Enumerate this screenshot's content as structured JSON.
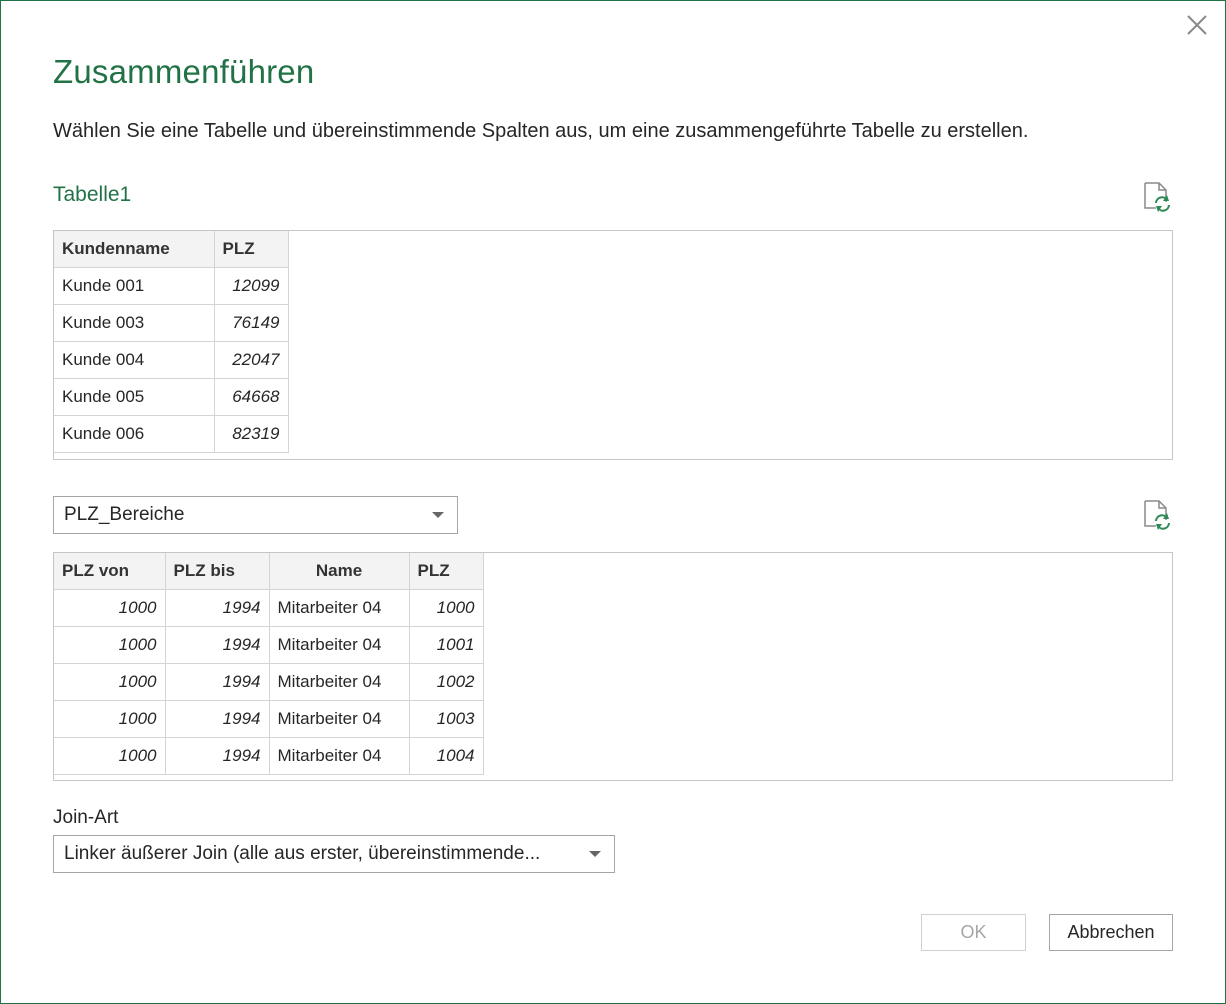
{
  "dialog": {
    "title": "Zusammenführen",
    "subtitle": "Wählen Sie eine Tabelle und übereinstimmende Spalten aus, um eine zusammengeführte Tabelle zu erstellen.",
    "accent_color": "#217346"
  },
  "table1": {
    "name": "Tabelle1",
    "columns": [
      "Kundenname",
      "PLZ"
    ],
    "rows": [
      [
        "Kunde 001",
        "12099"
      ],
      [
        "Kunde 003",
        "76149"
      ],
      [
        "Kunde 004",
        "22047"
      ],
      [
        "Kunde 005",
        "64668"
      ],
      [
        "Kunde 006",
        "82319"
      ]
    ]
  },
  "table2": {
    "selected": "PLZ_Bereiche",
    "columns": [
      "PLZ von",
      "PLZ bis",
      "Name",
      "PLZ"
    ],
    "rows": [
      [
        "1000",
        "1994",
        "Mitarbeiter 04",
        "1000"
      ],
      [
        "1000",
        "1994",
        "Mitarbeiter 04",
        "1001"
      ],
      [
        "1000",
        "1994",
        "Mitarbeiter 04",
        "1002"
      ],
      [
        "1000",
        "1994",
        "Mitarbeiter 04",
        "1003"
      ],
      [
        "1000",
        "1994",
        "Mitarbeiter 04",
        "1004"
      ]
    ]
  },
  "join": {
    "label": "Join-Art",
    "selected": "Linker äußerer Join (alle aus erster, übereinstimmende..."
  },
  "buttons": {
    "ok": "OK",
    "cancel": "Abbrechen"
  },
  "icons": {
    "close": "close-icon",
    "refresh": "refresh-preview-icon"
  }
}
